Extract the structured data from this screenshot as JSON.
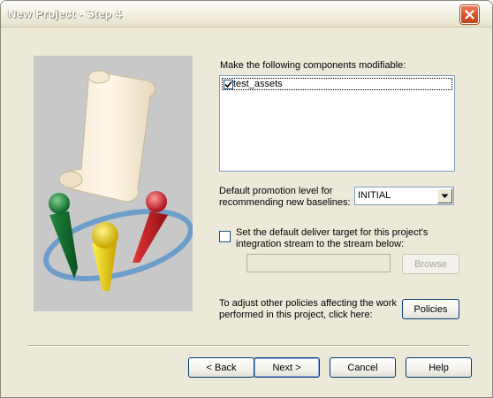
{
  "window": {
    "title": "New Project - Step 4"
  },
  "components": {
    "label": "Make the following components modifiable:",
    "items": [
      {
        "name": "test_assets",
        "checked": true
      }
    ]
  },
  "promotion": {
    "label_line1": "Default promotion level for",
    "label_line2": "recommending new baselines:",
    "selected": "INITIAL"
  },
  "deliver_target": {
    "label_line1": "Set the default deliver target for this project's",
    "label_line2": "integration stream to the stream below:",
    "checked": false,
    "stream_value": "",
    "browse_label": "Browse"
  },
  "policies": {
    "label_line1": "To adjust other policies affecting the work",
    "label_line2": "performed in this project, click here:",
    "button_label": "Policies"
  },
  "footer": {
    "back_label": "< Back",
    "next_label": "Next >",
    "cancel_label": "Cancel",
    "help_label": "Help"
  },
  "colors": {
    "dialog_bg": "#ece9d8",
    "close_button": "#d9552c",
    "accent_border": "#003c74"
  }
}
